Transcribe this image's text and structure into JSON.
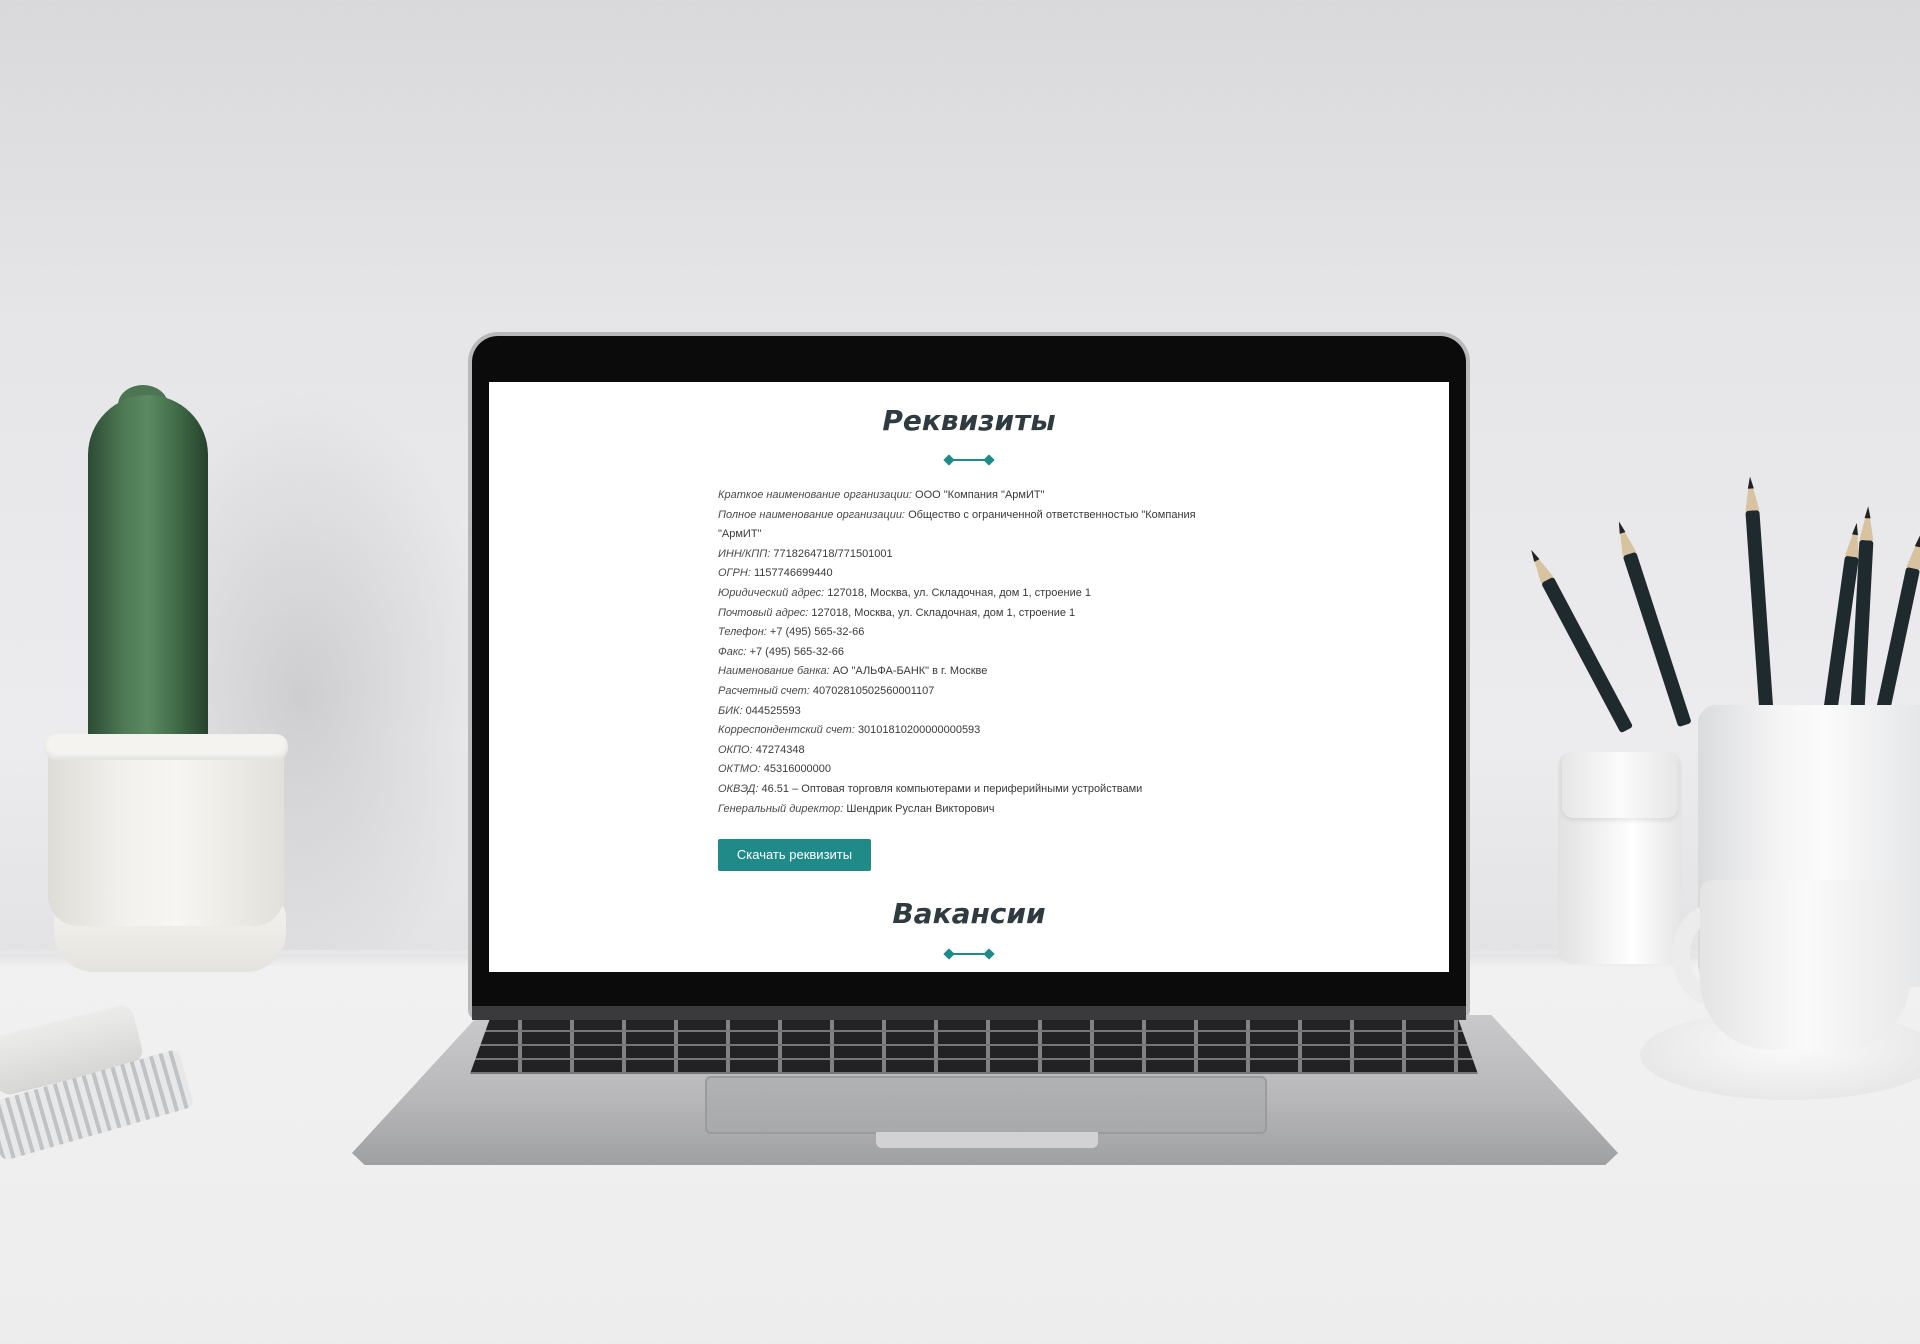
{
  "page": {
    "requisites_title": "Реквизиты",
    "vacancies_title": "Вакансии",
    "accent_color": "#1f8a88",
    "details": [
      {
        "label": "Краткое наименование организации:",
        "value": "ООО \"Компания \"АрмИТ\""
      },
      {
        "label": "Полное наименование организации:",
        "value": "Общество с ограниченной ответственностью \"Компания \"АрмИТ\""
      },
      {
        "label": "ИНН/КПП:",
        "value": "7718264718/771501001"
      },
      {
        "label": "ОГРН:",
        "value": "1157746699440"
      },
      {
        "label": "Юридический адрес:",
        "value": "127018, Москва, ул. Складочная, дом 1, строение 1"
      },
      {
        "label": "Почтовый адрес:",
        "value": "127018, Москва, ул. Складочная, дом 1, строение 1"
      },
      {
        "label": "Телефон:",
        "value": "+7 (495) 565-32-66"
      },
      {
        "label": "Факс:",
        "value": "+7 (495) 565-32-66"
      },
      {
        "label": "Наименование банка:",
        "value": "АО \"АЛЬФА-БАНК\" в г. Москве"
      },
      {
        "label": "Расчетный счет:",
        "value": "40702810502560001107"
      },
      {
        "label": "БИК:",
        "value": "044525593"
      },
      {
        "label": "Корреспондентский счет:",
        "value": "30101810200000000593"
      },
      {
        "label": "ОКПО:",
        "value": "47274348"
      },
      {
        "label": "ОКТМО:",
        "value": "45316000000"
      },
      {
        "label": "ОКВЭД:",
        "value": "46.51 – Оптовая торговля компьютерами и периферийными устройствами"
      },
      {
        "label": "Генеральный директор:",
        "value": "Шендрик Руслан Викторович"
      }
    ],
    "download_button": "Скачать реквизиты"
  }
}
